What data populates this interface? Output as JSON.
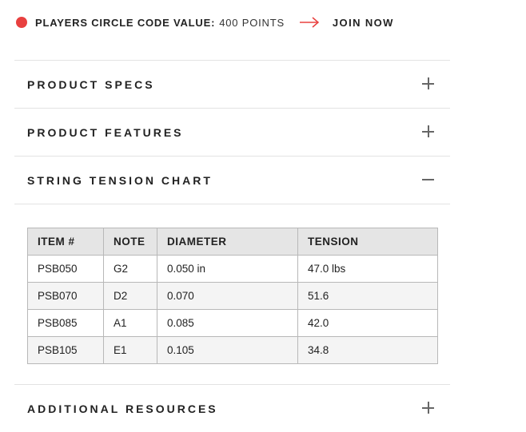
{
  "promo": {
    "label": "PLAYERS CIRCLE CODE VALUE:",
    "value": "400 POINTS",
    "cta": "JOIN NOW",
    "accent_color": "#e8403f",
    "dot_icon": "red-dot-icon",
    "arrow_icon": "arrow-right-icon"
  },
  "accordion": {
    "sections": [
      {
        "title": "PRODUCT SPECS",
        "expanded": false,
        "icon": "plus-icon"
      },
      {
        "title": "PRODUCT FEATURES",
        "expanded": false,
        "icon": "plus-icon"
      },
      {
        "title": "STRING TENSION CHART",
        "expanded": true,
        "icon": "minus-icon"
      },
      {
        "title": "ADDITIONAL RESOURCES",
        "expanded": false,
        "icon": "plus-icon"
      }
    ]
  },
  "tension_table": {
    "headers": [
      "ITEM #",
      "NOTE",
      "DIAMETER",
      "TENSION"
    ],
    "rows": [
      [
        "PSB050",
        "G2",
        "0.050 in",
        "47.0 lbs"
      ],
      [
        "PSB070",
        "D2",
        "0.070",
        "51.6"
      ],
      [
        "PSB085",
        "A1",
        "0.085",
        "42.0"
      ],
      [
        "PSB105",
        "E1",
        "0.105",
        "34.8"
      ]
    ]
  }
}
